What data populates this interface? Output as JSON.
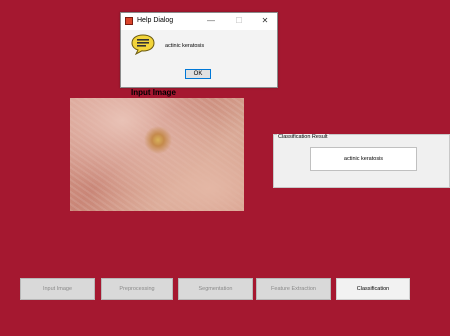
{
  "dialog": {
    "title": "Help Dialog",
    "minimize_glyph": "—",
    "maximize_glyph": "☐",
    "close_glyph": "✕",
    "message": "actinic keratosis",
    "ok_label": "OK"
  },
  "input_image": {
    "label": "Input Image"
  },
  "result": {
    "title": "Classification Result",
    "value": "actinic keratosis"
  },
  "buttons": {
    "input_image": "Input Image",
    "preprocessing": "Preprocessing",
    "segmentation": "Segmentation",
    "feature_extraction": "Feature Extraction",
    "classification": "Classification"
  },
  "colors": {
    "background": "#a51830",
    "dialog": "#f3f3f3",
    "ok_border": "#0078d7"
  }
}
